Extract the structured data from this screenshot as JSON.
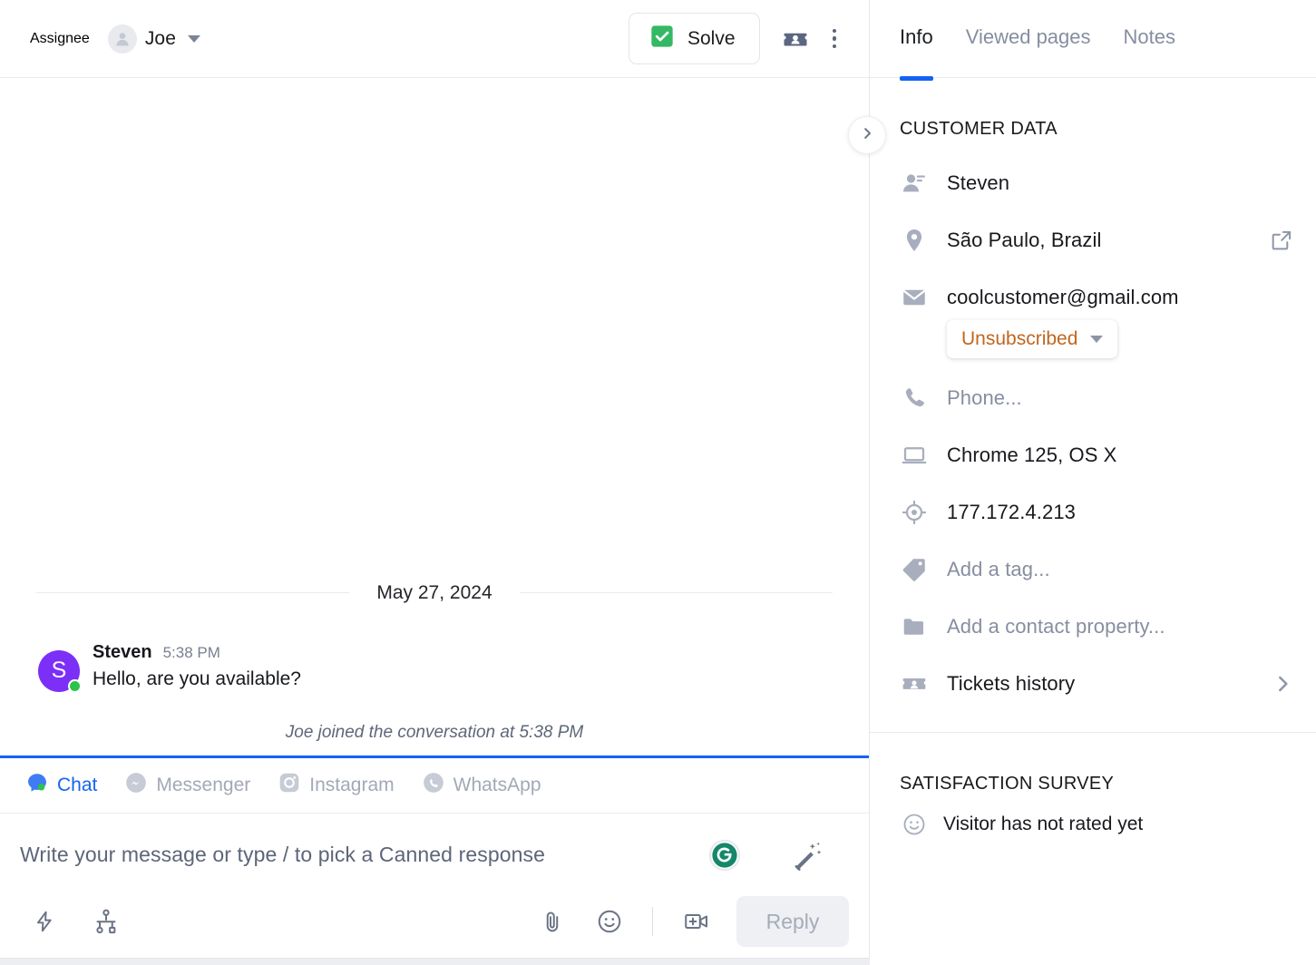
{
  "topbar": {
    "assignee_label": "Assignee",
    "assignee_name": "Joe",
    "avatar_icon": "person-icon",
    "caret_icon": "chevron-down-icon",
    "solve_label": "Solve",
    "solve_icon": "check-square-icon",
    "contact_card_icon": "contact-card-icon",
    "more_icon": "kebab-menu-icon"
  },
  "conversation": {
    "date_separator": "May 27, 2024",
    "messages": [
      {
        "author": "Steven",
        "time": "5:38 PM",
        "text": "Hello, are you available?",
        "avatar_initial": "S",
        "avatar_color": "#7b2ff7",
        "presence_color": "#2bc44a"
      }
    ],
    "system_note": "Joe joined the conversation at 5:38 PM"
  },
  "channels": {
    "items": [
      {
        "label": "Chat",
        "icon": "chat-bubble-icon",
        "active": true
      },
      {
        "label": "Messenger",
        "icon": "messenger-icon",
        "active": false
      },
      {
        "label": "Instagram",
        "icon": "instagram-icon",
        "active": false
      },
      {
        "label": "WhatsApp",
        "icon": "whatsapp-icon",
        "active": false
      }
    ],
    "active_color": "#1463f3",
    "inactive_color": "#a2a9b6"
  },
  "composer": {
    "placeholder": "Write your message or type / to pick a Canned response",
    "value": "",
    "grammarly_icon": "grammarly-icon",
    "ai_assist_icon": "magic-wand-icon"
  },
  "bottom_toolbar": {
    "left_icons": [
      {
        "name": "lightning-bolt-icon"
      },
      {
        "name": "flow-chart-icon"
      }
    ],
    "right_icons": [
      {
        "name": "paperclip-icon"
      },
      {
        "name": "emoji-smiley-icon"
      },
      {
        "name": "video-call-add-icon"
      }
    ],
    "reply_label": "Reply",
    "reply_disabled": true
  },
  "sidepanel": {
    "collapse_icon": "chevron-right-icon",
    "tabs": [
      {
        "label": "Info",
        "active": true
      },
      {
        "label": "Viewed pages",
        "active": false
      },
      {
        "label": "Notes",
        "active": false
      }
    ],
    "accent_color": "#1463f3",
    "customer_data": {
      "section_title": "CUSTOMER DATA",
      "rows": [
        {
          "icon": "person-details-icon",
          "value": "Steven",
          "muted": false,
          "action": ""
        },
        {
          "icon": "location-pin-icon",
          "value": "São Paulo, Brazil",
          "muted": false,
          "action": "external-link-icon"
        },
        {
          "icon": "envelope-icon",
          "value": "coolcustomer@gmail.com",
          "muted": false,
          "action": ""
        },
        {
          "icon": "phone-icon",
          "value": "Phone...",
          "muted": true,
          "action": ""
        },
        {
          "icon": "laptop-icon",
          "value": "Chrome 125, OS X",
          "muted": false,
          "action": ""
        },
        {
          "icon": "target-crosshair-icon",
          "value": "177.172.4.213",
          "muted": false,
          "action": ""
        },
        {
          "icon": "tag-icon",
          "value": "Add a tag...",
          "muted": true,
          "action": ""
        },
        {
          "icon": "folder-icon",
          "value": "Add a contact property...",
          "muted": true,
          "action": ""
        },
        {
          "icon": "ticket-person-icon",
          "value": "Tickets history",
          "muted": false,
          "action": "chevron-right-icon"
        }
      ],
      "subscription_badge": {
        "label": "Unsubscribed",
        "color": "#c2651c",
        "caret_icon": "chevron-down-icon"
      }
    },
    "satisfaction": {
      "section_title": "SATISFACTION SURVEY",
      "icon": "smiley-face-icon",
      "status": "Visitor has not rated yet"
    }
  }
}
